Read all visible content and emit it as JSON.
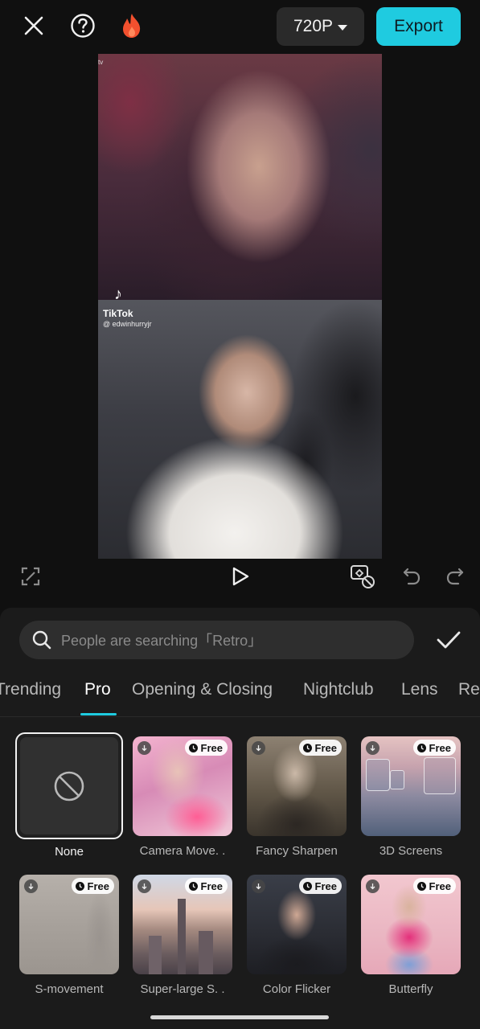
{
  "topbar": {
    "close_icon": "close-icon",
    "help_icon": "help-icon",
    "pro_icon": "flame-icon",
    "resolution": "720P",
    "export_label": "Export"
  },
  "preview": {
    "tiktok_label": "TikTok",
    "tiktok_user": "@ edwinhurryjr",
    "corner_watermark": "tv"
  },
  "controls": {
    "fullscreen_icon": "fullscreen-icon",
    "play_icon": "play-icon",
    "keyframe_icon": "keyframe-icon",
    "undo_icon": "undo-icon",
    "redo_icon": "redo-icon"
  },
  "search": {
    "placeholder": "People are searching「Retro」"
  },
  "tabs": [
    {
      "label": "Trending"
    },
    {
      "label": "Pro"
    },
    {
      "label": "Opening & Closing"
    },
    {
      "label": "Nightclub"
    },
    {
      "label": "Lens"
    },
    {
      "label": "Re"
    }
  ],
  "effects": [
    {
      "label": "None"
    },
    {
      "label": "Camera Move. .",
      "badge": "Free"
    },
    {
      "label": "Fancy Sharpen",
      "badge": "Free"
    },
    {
      "label": "3D Screens",
      "badge": "Free"
    },
    {
      "label": "S-movement",
      "badge": "Free"
    },
    {
      "label": "Super-large S. .",
      "badge": "Free"
    },
    {
      "label": "Color Flicker",
      "badge": "Free"
    },
    {
      "label": "Butterfly",
      "badge": "Free"
    }
  ],
  "colors": {
    "accent": "#1fcbe0",
    "flame": "#f2502e",
    "background": "#101010",
    "panel": "#1b1b1b"
  }
}
